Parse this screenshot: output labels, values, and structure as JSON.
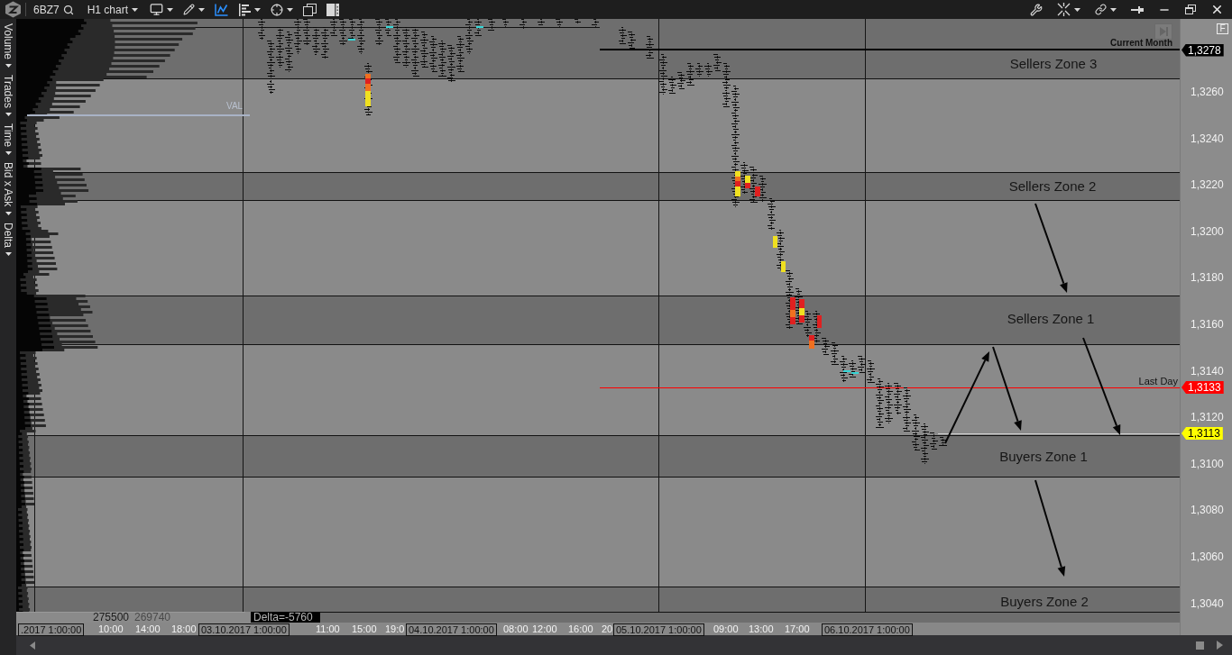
{
  "toolbar": {
    "symbol": "6BZ7",
    "chart_menu": "H1 chart",
    "chart_toggle": {
      "on": true
    }
  },
  "indicator_tabs": [
    {
      "label": "Volume"
    },
    {
      "label": "Trades"
    },
    {
      "label": "Time"
    },
    {
      "label": "Bid x Ask"
    },
    {
      "label": "Delta"
    }
  ],
  "chart": {
    "zones": [
      {
        "label": "Sellers Zone 3"
      },
      {
        "label": "Sellers Zone 2"
      },
      {
        "label": "Sellers Zone 1"
      },
      {
        "label": "Buyers Zone 1"
      },
      {
        "label": "Buyers Zone 2"
      }
    ],
    "levels": [
      {
        "kind": "month",
        "label": "Current Month",
        "price": "1,3278",
        "color": "#000000"
      },
      {
        "kind": "day",
        "label": "Last Day",
        "price": "1,3133",
        "color": "#ff0000"
      },
      {
        "kind": "last",
        "price": "1,3113",
        "color": "#ffff00"
      }
    ],
    "profile": {
      "val_label": "VAL"
    },
    "price_axis": [
      "1,3260",
      "1,3240",
      "1,3220",
      "1,3200",
      "1,3180",
      "1,3160",
      "1,3140",
      "1,3120",
      "1,3100",
      "1,3080",
      "1,3060",
      "1,3040"
    ],
    "time_axis": [
      {
        "kind": "date",
        "text": ".2017 1:00:00"
      },
      {
        "kind": "time",
        "text": "10:00"
      },
      {
        "kind": "time",
        "text": "14:00"
      },
      {
        "kind": "time",
        "text": "18:00"
      },
      {
        "kind": "date",
        "text": "03.10.2017 1:00:00"
      },
      {
        "kind": "time",
        "text": "11:00"
      },
      {
        "kind": "time",
        "text": "15:00"
      },
      {
        "kind": "time",
        "text": "19:0"
      },
      {
        "kind": "date",
        "text": "04.10.2017 1:00:00"
      },
      {
        "kind": "time",
        "text": "08:00"
      },
      {
        "kind": "time",
        "text": "12:00"
      },
      {
        "kind": "time",
        "text": "16:00"
      },
      {
        "kind": "time",
        "text": "20"
      },
      {
        "kind": "date",
        "text": "05.10.2017 1:00:00"
      },
      {
        "kind": "time",
        "text": "09:00"
      },
      {
        "kind": "time",
        "text": "13:00"
      },
      {
        "kind": "time",
        "text": "17:00"
      },
      {
        "kind": "date",
        "text": "06.10.2017 1:00:00"
      }
    ],
    "footer_values": [
      "275500",
      "269740"
    ],
    "delta": "Delta=-5760",
    "frame_button": "F"
  }
}
